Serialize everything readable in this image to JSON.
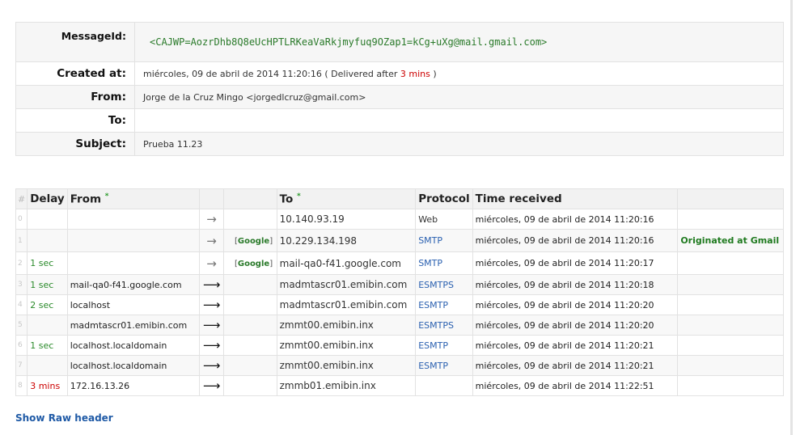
{
  "header": {
    "message_id_label": "MessageId:",
    "message_id": "<CAJWP=AozrDhb8Q8eUcHPTLRKeaVaRkjmyfuq9OZap1=kCg+uXg@mail.gmail.com>",
    "created_label": "Created at:",
    "created_value": "miércoles, 09 de abril de 2014 11:20:16",
    "delivered_prefix": "( Delivered after",
    "delivered_delay": "3 mins",
    "delivered_suffix": ")",
    "from_label": "From:",
    "from_value": "Jorge de la Cruz Mingo <jorgedlcruz@gmail.com>",
    "to_label": "To:",
    "to_value": "",
    "subject_label": "Subject:",
    "subject_value": "Prueba 11.23"
  },
  "hops": {
    "columns": {
      "num": "#",
      "delay": "Delay",
      "from": "From",
      "from_star": "*",
      "to": "To",
      "to_star": "*",
      "protocol": "Protocol",
      "time": "Time received"
    },
    "google_tag": "Google",
    "rows": [
      {
        "n": "0",
        "delay": "",
        "from": "",
        "arrow": "→",
        "google": false,
        "to": "10.140.93.19",
        "protocol": "Web",
        "time": "miércoles, 09 de abril de 2014 11:20:16",
        "note": ""
      },
      {
        "n": "1",
        "delay": "",
        "from": "",
        "arrow": "→",
        "google": true,
        "to": "10.229.134.198",
        "protocol": "SMTP",
        "time": "miércoles, 09 de abril de 2014 11:20:16",
        "note": "Originated at Gmail"
      },
      {
        "n": "2",
        "delay": "1 sec",
        "from": "",
        "arrow": "→",
        "google": true,
        "to": "mail-qa0-f41.google.com",
        "protocol": "SMTP",
        "time": "miércoles, 09 de abril de 2014 11:20:17",
        "note": ""
      },
      {
        "n": "3",
        "delay": "1 sec",
        "from": "mail-qa0-f41.google.com",
        "arrow": "⟶",
        "google": false,
        "to": "madmtascr01.emibin.com",
        "protocol": "ESMTPS",
        "time": "miércoles, 09 de abril de 2014 11:20:18",
        "note": ""
      },
      {
        "n": "4",
        "delay": "2 sec",
        "from": "localhost",
        "arrow": "⟶",
        "google": false,
        "to": "madmtascr01.emibin.com",
        "protocol": "ESMTP",
        "time": "miércoles, 09 de abril de 2014 11:20:20",
        "note": ""
      },
      {
        "n": "5",
        "delay": "",
        "from": "madmtascr01.emibin.com",
        "arrow": "⟶",
        "google": false,
        "to": "zmmt00.emibin.inx",
        "protocol": "ESMTPS",
        "time": "miércoles, 09 de abril de 2014 11:20:20",
        "note": ""
      },
      {
        "n": "6",
        "delay": "1 sec",
        "from": "localhost.localdomain",
        "arrow": "⟶",
        "google": false,
        "to": "zmmt00.emibin.inx",
        "protocol": "ESMTP",
        "time": "miércoles, 09 de abril de 2014 11:20:21",
        "note": ""
      },
      {
        "n": "7",
        "delay": "",
        "from": "localhost.localdomain",
        "arrow": "⟶",
        "google": false,
        "to": "zmmt00.emibin.inx",
        "protocol": "ESMTP",
        "time": "miércoles, 09 de abril de 2014 11:20:21",
        "note": ""
      },
      {
        "n": "8",
        "delay": "3 mins",
        "from": "172.16.13.26",
        "arrow": "⟶",
        "google": false,
        "to": "zmmb01.emibin.inx",
        "protocol": "",
        "time": "miércoles, 09 de abril de 2014 11:22:51",
        "note": ""
      }
    ]
  },
  "links": {
    "show_raw": "Show Raw header"
  },
  "colors": {
    "delay_green": "#2a8a2a",
    "delay_red": "#cc0000",
    "protocol_blue": "#2a60b0",
    "link_blue": "#1f5aa6",
    "message_id_green": "#2a7a2a"
  }
}
